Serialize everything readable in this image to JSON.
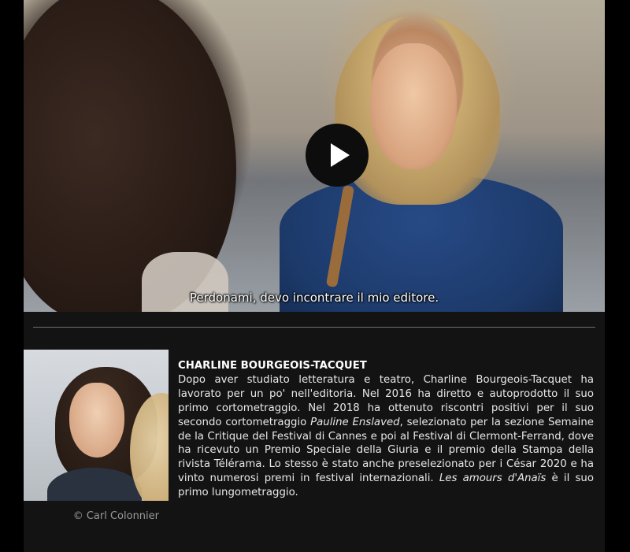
{
  "video": {
    "subtitle": "Perdonami, devo incontrare il mio editore."
  },
  "icons": {
    "play": "play-icon"
  },
  "photo": {
    "caption": "© Carl Colonnier"
  },
  "bio": {
    "name": "CHARLINE BOURGEOIS-TACQUET",
    "t1": "Dopo aver studiato letteratura e teatro, Charline Bourgeois-Tacquet ha lavorato per un po' nell'editoria. Nel 2016 ha diretto e autoprodotto il suo primo cortometraggio. Nel 2018 ha ottenuto riscontri positivi per il suo secondo cortometraggio ",
    "film1": "Pauline Enslaved",
    "t2": ", selezionato per la sezione Semaine de la Critique del Festival di Cannes e poi al Festival di Clermont-Ferrand, dove ha ricevuto un Premio Speciale della Giuria e il premio della Stampa della rivista Télérama. Lo stesso è stato anche preselezionato per i César 2020 e ha vinto numerosi premi in festival internazionali. ",
    "film2": "Les amours d'Anaïs",
    "t3": " è il suo primo lungometraggio."
  },
  "colors": {
    "page_background": "#000000",
    "panel_background": "#131313",
    "text": "#e8e8e8",
    "caption": "#9a9a9a",
    "divider": "#6f6f6f"
  }
}
